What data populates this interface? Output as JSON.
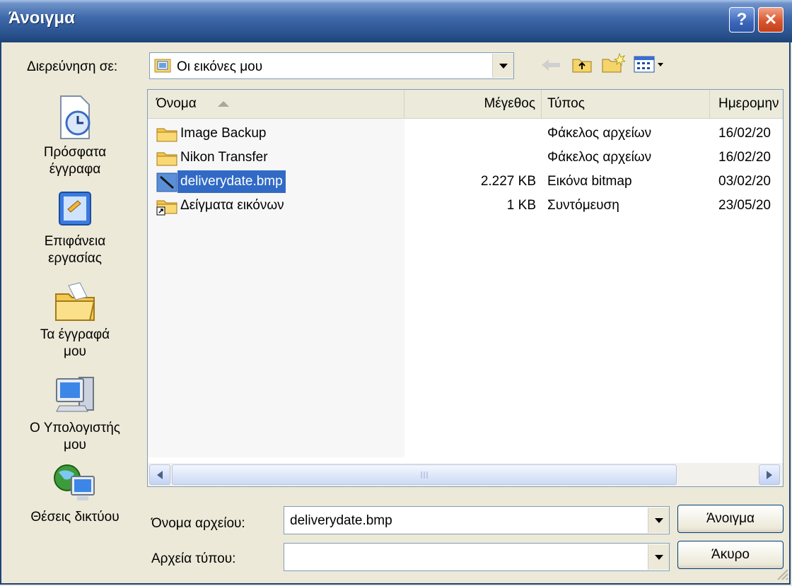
{
  "window": {
    "title": "Άνοιγμα",
    "help_glyph": "?",
    "close_glyph": "✕",
    "accent": "#316ac5"
  },
  "lookin": {
    "label": "Διερεύνηση σε:",
    "value": "Οι εικόνες μου"
  },
  "places": [
    {
      "label1": "Πρόσφατα",
      "label2": "έγγραφα",
      "icon": "recent-documents-icon"
    },
    {
      "label1": "Επιφάνεια",
      "label2": "εργασίας",
      "icon": "desktop-icon"
    },
    {
      "label1": "Τα έγγραφά",
      "label2": "μου",
      "icon": "my-documents-icon"
    },
    {
      "label1": "Ο Υπολογιστής",
      "label2": "μου",
      "icon": "my-computer-icon"
    },
    {
      "label1": "Θέσεις δικτύου",
      "label2": "",
      "icon": "network-places-icon"
    }
  ],
  "columns": {
    "name": "Όνομα",
    "size": "Μέγεθος",
    "type": "Τύπος",
    "date": "Ημερομην"
  },
  "files": [
    {
      "name": "Image Backup",
      "size": "",
      "type": "Φάκελος αρχείων",
      "date": "16/02/20",
      "icon": "folder-icon"
    },
    {
      "name": "Nikon Transfer",
      "size": "",
      "type": "Φάκελος αρχείων",
      "date": "16/02/20",
      "icon": "folder-icon"
    },
    {
      "name": "deliverydate.bmp",
      "size": "2.227 KB",
      "type": "Εικόνα bitmap",
      "date": "03/02/20",
      "icon": "bitmap-file-icon",
      "selected": true
    },
    {
      "name": "Δείγματα εικόνων",
      "size": "1 KB",
      "type": "Συντόμευση",
      "date": "23/05/20",
      "icon": "folder-shortcut-icon"
    }
  ],
  "filename": {
    "label": "Όνομα αρχείου:",
    "value": "deliverydate.bmp"
  },
  "filetype": {
    "label": "Αρχεία τύπου:",
    "value": ""
  },
  "buttons": {
    "open": "Άνοιγμα",
    "cancel": "Άκυρο"
  }
}
